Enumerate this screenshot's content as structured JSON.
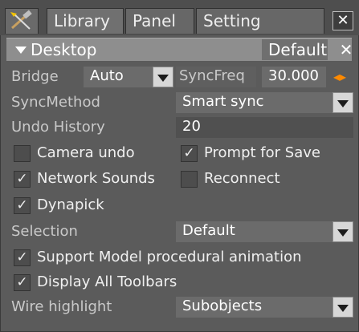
{
  "tabs": [
    {
      "label": "Library"
    },
    {
      "label": "Panel"
    },
    {
      "label": "Setting"
    }
  ],
  "section": {
    "title": "Desktop",
    "preset": "Default",
    "close_glyph": "✕"
  },
  "close_glyph": "✕",
  "fields": {
    "bridge_label": "Bridge",
    "bridge_value": "Auto",
    "syncfreq_label": "SyncFreq",
    "syncfreq_value": "30.000",
    "syncmethod_label": "SyncMethod",
    "syncmethod_value": "Smart sync",
    "undo_label": "Undo History",
    "undo_value": "20",
    "selection_label": "Selection",
    "selection_value": "Default",
    "wire_label": "Wire highlight",
    "wire_value": "Subobjects"
  },
  "checkboxes": {
    "camera_undo": {
      "label": "Camera undo",
      "checked": false
    },
    "prompt_save": {
      "label": "Prompt for Save",
      "checked": true
    },
    "network_sounds": {
      "label": "Network Sounds",
      "checked": true
    },
    "reconnect": {
      "label": "Reconnect",
      "checked": false
    },
    "dynapick": {
      "label": "Dynapick",
      "checked": true
    },
    "support_model": {
      "label": "Support Model procedural animation",
      "checked": true
    },
    "display_toolbars": {
      "label": "Display All Toolbars",
      "checked": true
    }
  },
  "check_glyph": "✓",
  "colors": {
    "spinner_accent": "#ff8a00",
    "header_bg": "#8e8e8e"
  }
}
